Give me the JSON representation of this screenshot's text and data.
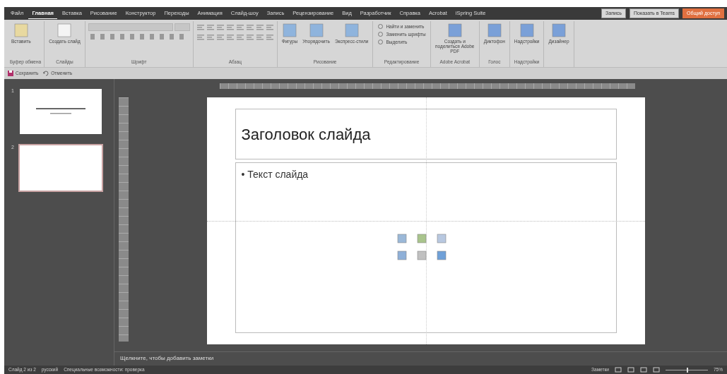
{
  "tabs": [
    {
      "label": "Файл",
      "selected": false
    },
    {
      "label": "Главная",
      "selected": true
    },
    {
      "label": "Вставка",
      "selected": false
    },
    {
      "label": "Рисование",
      "selected": false
    },
    {
      "label": "Конструктор",
      "selected": false
    },
    {
      "label": "Переходы",
      "selected": false
    },
    {
      "label": "Анимация",
      "selected": false
    },
    {
      "label": "Слайд-шоу",
      "selected": false
    },
    {
      "label": "Запись",
      "selected": false
    },
    {
      "label": "Рецензирование",
      "selected": false
    },
    {
      "label": "Вид",
      "selected": false
    },
    {
      "label": "Разработчик",
      "selected": false
    },
    {
      "label": "Справка",
      "selected": false
    },
    {
      "label": "Acrobat",
      "selected": false
    },
    {
      "label": "iSpring Suite",
      "selected": false
    }
  ],
  "title_buttons": [
    {
      "label": "Запись",
      "kind": "record"
    },
    {
      "label": "Показать в Teams",
      "kind": "teams"
    },
    {
      "label": "Общий доступ",
      "kind": "share"
    }
  ],
  "ribbon_groups": [
    {
      "label": "Буфер обмена",
      "kind": "clipboard",
      "buttons": [
        "Вставить"
      ]
    },
    {
      "label": "Слайды",
      "kind": "slides",
      "buttons": [
        "Создать слайд"
      ]
    },
    {
      "label": "Шрифт",
      "kind": "font"
    },
    {
      "label": "Абзац",
      "kind": "paragraph"
    },
    {
      "label": "Рисование",
      "kind": "drawing",
      "buttons": [
        "Фигуры",
        "Упорядочить",
        "Экспресс-стили"
      ]
    },
    {
      "label": "Редактирование",
      "kind": "editing",
      "buttons": [
        "Найти и заменить",
        "Заменить шрифты",
        "Выделить"
      ]
    },
    {
      "label": "Adobe Acrobat",
      "kind": "big",
      "buttons": [
        "Создать и поделиться Adobe PDF"
      ]
    },
    {
      "label": "Голос",
      "kind": "big",
      "buttons": [
        "Диктофон"
      ]
    },
    {
      "label": "Надстройки",
      "kind": "big",
      "buttons": [
        "Надстройки"
      ]
    },
    {
      "kind": "big",
      "buttons": [
        "Дизайнер"
      ]
    }
  ],
  "quick_access": [
    "Сохранить",
    "Отменить"
  ],
  "slides": [
    {
      "number": "1",
      "selected": false,
      "kind": "title"
    },
    {
      "number": "2",
      "selected": true,
      "kind": "blank"
    }
  ],
  "slide": {
    "title": "Заголовок слайда",
    "bullets": [
      "• Текст слайда"
    ]
  },
  "notes_placeholder": "Щелкните, чтобы добавить заметки",
  "status_bar": {
    "slide": "Слайд 2 из 2",
    "language": "русский",
    "accessibility": "Специальные возможности: проверка",
    "notes": "Заметки",
    "zoom": "75%",
    "zoom_slider": {
      "level": 0.5
    }
  }
}
